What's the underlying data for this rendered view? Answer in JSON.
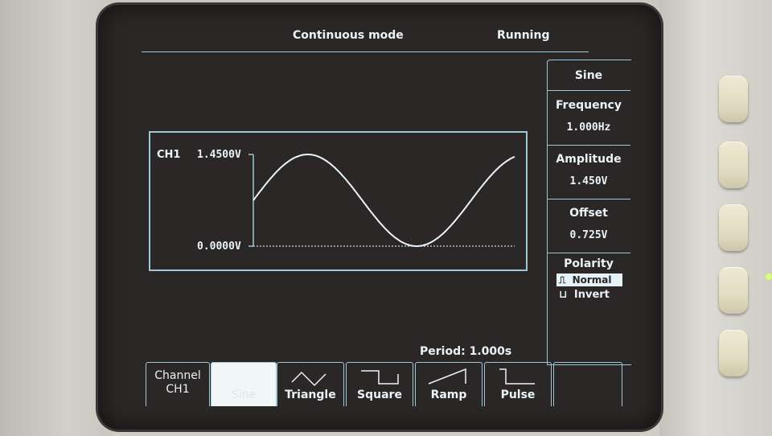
{
  "header": {
    "mode": "Continuous mode",
    "status": "Running"
  },
  "side_menu": {
    "title": "Sine",
    "frequency": {
      "label": "Frequency",
      "value": "1.000Hz"
    },
    "amplitude": {
      "label": "Amplitude",
      "value": "1.450V"
    },
    "offset": {
      "label": "Offset",
      "value": "0.725V"
    },
    "polarity": {
      "label": "Polarity",
      "options": [
        "Normal",
        "Invert"
      ],
      "selected": "Normal"
    }
  },
  "graph": {
    "channel": "CH1",
    "top_label": "1.4500V",
    "bottom_label": "0.0000V",
    "period": "Period: 1.000s",
    "waveform": "sine",
    "min_v": 0.0,
    "max_v": 1.45
  },
  "bottom_menu": {
    "channel": {
      "line1": "Channel",
      "line2": "CH1"
    },
    "tabs": [
      "Sine",
      "Triangle",
      "Square",
      "Ramp",
      "Pulse"
    ],
    "selected": "Sine"
  },
  "colors": {
    "screen_bg": "#2a2726",
    "trace": "#e9f3f8",
    "frame": "#9fc7d6"
  }
}
